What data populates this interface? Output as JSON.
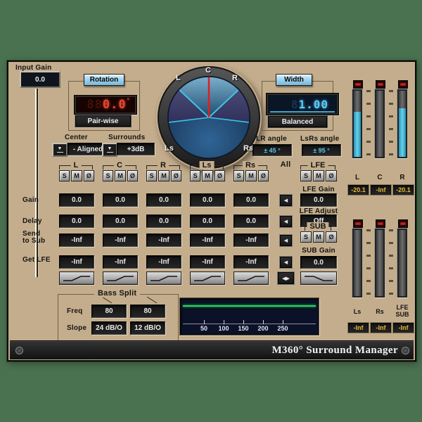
{
  "window": {
    "title": "M360° Surround Manager"
  },
  "colors": {
    "background": "#4a7150",
    "face": "#c4ad8c",
    "led_red": "#e84330",
    "led_blue": "#58ccf6",
    "meter_fill": "#3fb4d8",
    "graph_line": "#2ed45c",
    "meter_value_text": "#e8b83a"
  },
  "input_gain": {
    "label": "Input Gain",
    "value": "0.0"
  },
  "rotation": {
    "label": "Rotation",
    "ghost": "88",
    "value": "0.0",
    "unit": "°",
    "mode": "Pair-wise"
  },
  "center_select": {
    "label": "Center",
    "value": "- Aligned"
  },
  "surrounds_select": {
    "label": "Surrounds",
    "value": "+3dB"
  },
  "width": {
    "label": "Width",
    "ghost": "8",
    "value": "1.00",
    "mode": "Balanced"
  },
  "lr_angle": {
    "label": "LR angle",
    "value": "± 45 °"
  },
  "lsrs_angle": {
    "label": "LsRs angle",
    "value": "± 95 °"
  },
  "scope": {
    "labels": {
      "c": "C",
      "l": "L",
      "r": "R",
      "ls": "Ls",
      "rs": "Rs"
    }
  },
  "grid": {
    "solo": "S",
    "mute": "M",
    "phase": "Ø",
    "all_label": "All",
    "rows": {
      "gain": "Gain",
      "delay": "Delay",
      "send1": "Send",
      "send2": "to Sub",
      "get": "Get LFE"
    },
    "strips": [
      {
        "name": "L",
        "gain": "0.0",
        "delay": "0.0",
        "send": "-Inf",
        "get": "-Inf"
      },
      {
        "name": "C",
        "gain": "0.0",
        "delay": "0.0",
        "send": "-Inf",
        "get": "-Inf"
      },
      {
        "name": "R",
        "gain": "0.0",
        "delay": "0.0",
        "send": "-Inf",
        "get": "-Inf"
      },
      {
        "name": "Ls",
        "gain": "0.0",
        "delay": "0.0",
        "send": "-Inf",
        "get": "-Inf"
      },
      {
        "name": "Rs",
        "gain": "0.0",
        "delay": "0.0",
        "send": "-Inf",
        "get": "-Inf"
      }
    ],
    "lfe": {
      "name": "LFE",
      "gain_label": "LFE Gain",
      "gain": "0.0",
      "adjust_label": "LFE Adjust",
      "adjust": "Off",
      "sub_label": "SUB",
      "sub_gain_label": "SUB Gain",
      "sub_gain": "0.0"
    }
  },
  "bass_split": {
    "label": "Bass Split",
    "freq_label": "Freq",
    "freq1": "80",
    "freq2": "80",
    "slope_label": "Slope",
    "slope1": "24 dB/O",
    "slope2": "12 dB/O"
  },
  "graph": {
    "ticks": [
      "50",
      "100",
      "150",
      "200",
      "250"
    ]
  },
  "meters": {
    "top": [
      {
        "label": "L",
        "value": "-20.1",
        "level": 0.68
      },
      {
        "label": "C",
        "value": "-Inf",
        "level": 0
      },
      {
        "label": "R",
        "value": "-20.1",
        "level": 0.73
      }
    ],
    "bottom": [
      {
        "label": "Ls",
        "value": "-Inf",
        "level": 0
      },
      {
        "label": "Rs",
        "value": "-Inf",
        "level": 0
      },
      {
        "label": "LFE",
        "label2": "SUB",
        "value": "-Inf",
        "level": 0
      }
    ]
  }
}
